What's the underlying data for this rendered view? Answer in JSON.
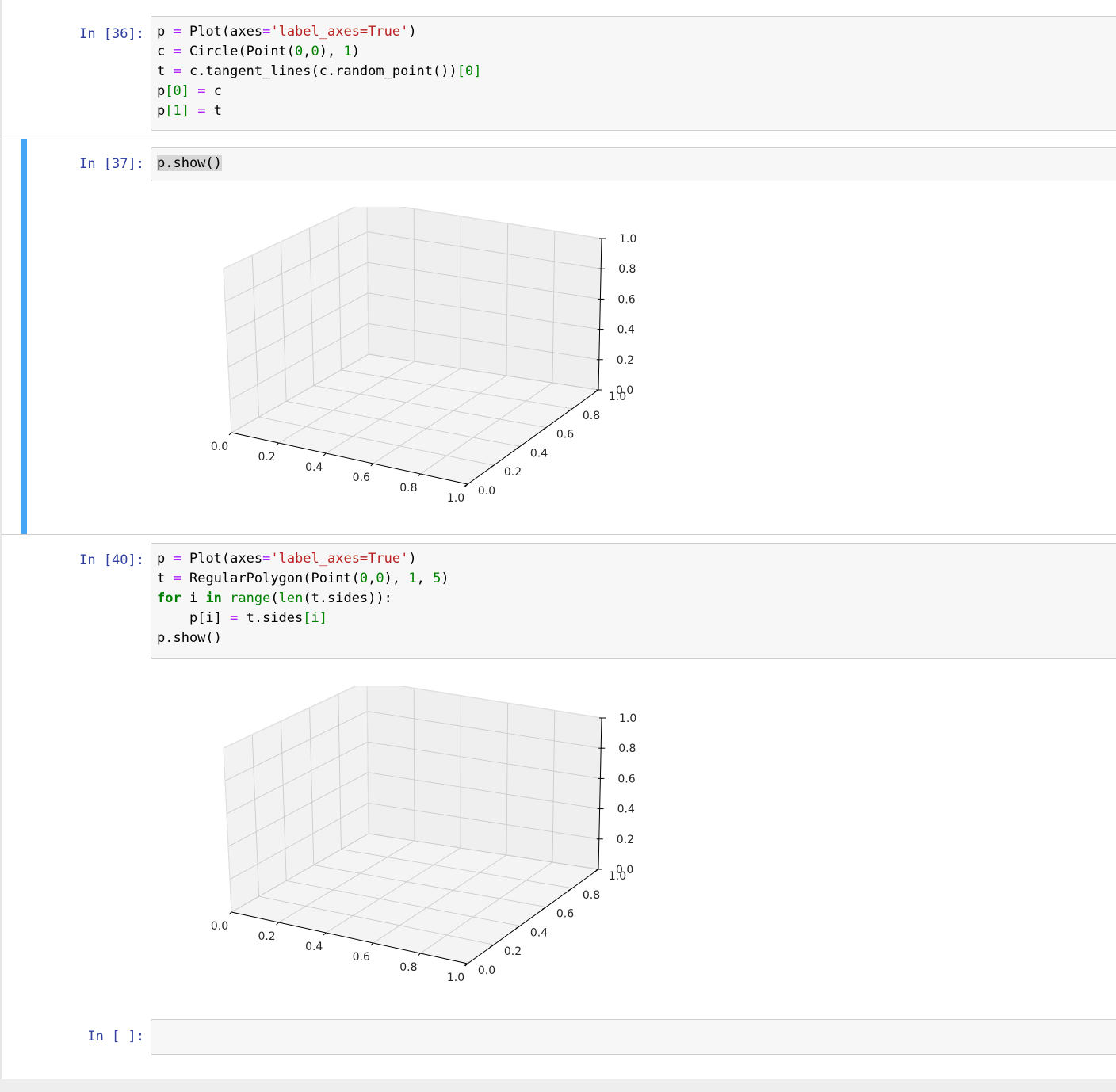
{
  "cells": [
    {
      "prompt": "In [36]:",
      "code_lines": [
        [
          [
            "p ",
            ""
          ],
          [
            "=",
            "op"
          ],
          [
            " Plot(axes",
            ""
          ],
          [
            "=",
            "op"
          ],
          [
            "'label_axes=True'",
            "str"
          ],
          [
            ")",
            ""
          ]
        ],
        [
          [
            "c ",
            ""
          ],
          [
            "=",
            "op"
          ],
          [
            " Circle(Point(",
            ""
          ],
          [
            "0",
            "num"
          ],
          [
            ",",
            ""
          ],
          [
            "0",
            "num"
          ],
          [
            "), ",
            ""
          ],
          [
            "1",
            "num"
          ],
          [
            ")",
            ""
          ]
        ],
        [
          [
            "t ",
            ""
          ],
          [
            "=",
            "op"
          ],
          [
            " c.tangent_lines(c.random_point())",
            ""
          ],
          [
            "[",
            "bracket"
          ],
          [
            "0",
            "num"
          ],
          [
            "]",
            "bracket"
          ]
        ],
        [
          [
            "p",
            ""
          ],
          [
            "[",
            "bracket"
          ],
          [
            "0",
            "num"
          ],
          [
            "]",
            "bracket"
          ],
          [
            " ",
            ""
          ],
          [
            "=",
            "op"
          ],
          [
            " c",
            ""
          ]
        ],
        [
          [
            "p",
            ""
          ],
          [
            "[",
            "bracket"
          ],
          [
            "1",
            "num"
          ],
          [
            "]",
            "bracket"
          ],
          [
            " ",
            ""
          ],
          [
            "=",
            "op"
          ],
          [
            " t",
            ""
          ]
        ]
      ]
    },
    {
      "prompt": "In [37]:",
      "code_lines": [
        [
          [
            "p.show()",
            "sel"
          ]
        ]
      ],
      "selected": true
    },
    {
      "prompt": "In [40]:",
      "code_lines": [
        [
          [
            "p ",
            ""
          ],
          [
            "=",
            "op"
          ],
          [
            " Plot(axes",
            ""
          ],
          [
            "=",
            "op"
          ],
          [
            "'label_axes=True'",
            "str"
          ],
          [
            ")",
            ""
          ]
        ],
        [
          [
            "t ",
            ""
          ],
          [
            "=",
            "op"
          ],
          [
            " RegularPolygon(Point(",
            ""
          ],
          [
            "0",
            "num"
          ],
          [
            ",",
            ""
          ],
          [
            "0",
            "num"
          ],
          [
            "), ",
            ""
          ],
          [
            "1",
            "num"
          ],
          [
            ", ",
            ""
          ],
          [
            "5",
            "num"
          ],
          [
            ")",
            ""
          ]
        ],
        [
          [
            "for",
            "kw"
          ],
          [
            " i ",
            ""
          ],
          [
            "in",
            "kw"
          ],
          [
            " ",
            ""
          ],
          [
            "range",
            "builtin"
          ],
          [
            "(",
            ""
          ],
          [
            "len",
            "builtin"
          ],
          [
            "(t.sides)):",
            ""
          ]
        ],
        [
          [
            "    p[i] ",
            ""
          ],
          [
            "=",
            "op"
          ],
          [
            " t.sides",
            ""
          ],
          [
            "[",
            "bracket"
          ],
          [
            "i",
            "num"
          ],
          [
            "]",
            "bracket"
          ]
        ],
        [
          [
            "p.show()",
            ""
          ]
        ]
      ]
    },
    {
      "prompt": "In [ ]:",
      "code_lines": []
    }
  ],
  "chart_data": [
    {
      "type": "scatter",
      "projection": "3d",
      "series": [],
      "x_ticks": [
        "0.0",
        "0.2",
        "0.4",
        "0.6",
        "0.8",
        "1.0"
      ],
      "y_ticks": [
        "0.0",
        "0.2",
        "0.4",
        "0.6",
        "0.8",
        "1.0"
      ],
      "z_ticks": [
        "0.0",
        "0.2",
        "0.4",
        "0.6",
        "0.8",
        "1.0"
      ],
      "xlim": [
        0,
        1
      ],
      "ylim": [
        0,
        1
      ],
      "zlim": [
        0,
        1
      ],
      "grid": true
    },
    {
      "type": "scatter",
      "projection": "3d",
      "series": [],
      "x_ticks": [
        "0.0",
        "0.2",
        "0.4",
        "0.6",
        "0.8",
        "1.0"
      ],
      "y_ticks": [
        "0.0",
        "0.2",
        "0.4",
        "0.6",
        "0.8",
        "1.0"
      ],
      "z_ticks": [
        "0.0",
        "0.2",
        "0.4",
        "0.6",
        "0.8",
        "1.0"
      ],
      "xlim": [
        0,
        1
      ],
      "ylim": [
        0,
        1
      ],
      "zlim": [
        0,
        1
      ],
      "grid": true
    }
  ],
  "colors": {
    "prompt": "#303f9f",
    "selection_bar": "#42a5f5",
    "operator": "#aa22ff",
    "string": "#ba2121",
    "number": "#008000",
    "keyword": "#008000"
  }
}
